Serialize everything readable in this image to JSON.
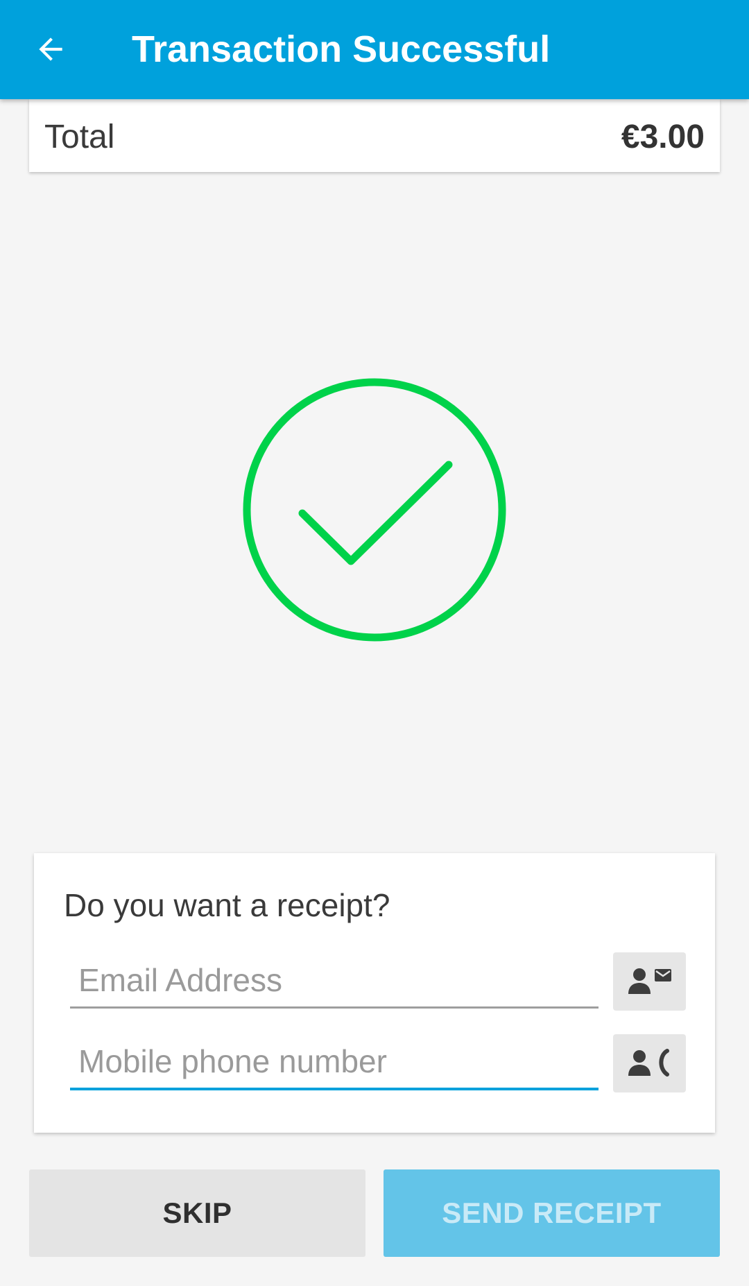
{
  "appbar": {
    "title": "Transaction Successful",
    "back_icon": "arrow-back-icon",
    "background_color": "#00a1dc"
  },
  "total": {
    "label": "Total",
    "amount": "€3.00"
  },
  "status": {
    "icon": "check-circle-icon",
    "color": "#00d24a"
  },
  "receipt": {
    "title": "Do you want a receipt?",
    "email_placeholder": "Email Address",
    "email_value": "",
    "email_contact_icon": "contact-mail-icon",
    "phone_placeholder": "Mobile phone number",
    "phone_value": "",
    "phone_contact_icon": "contact-phone-icon",
    "active_field_color": "#00a1dc"
  },
  "actions": {
    "skip_label": "SKIP",
    "send_label": "SEND RECEIPT",
    "send_color": "#63c4e8"
  }
}
